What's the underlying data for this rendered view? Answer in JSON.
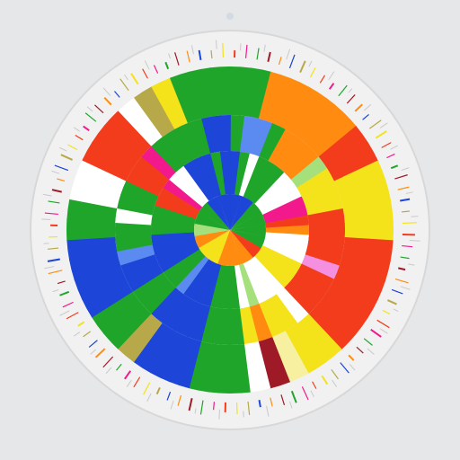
{
  "canvas": {
    "background": "#e6e7e9",
    "disc_fill": "#f1f1f1",
    "disc_stroke": "#d8d8d8",
    "top_dot": "#d4dae2"
  },
  "palette": {
    "red": "#f23c1c",
    "orange": "#ff8c10",
    "yellow": "#f4e21a",
    "lightyellow": "#f7f0a0",
    "green": "#1fa62a",
    "lightgreen": "#a6e07d",
    "blue": "#1d45d8",
    "lightblue": "#5b8af0",
    "magenta": "#f2198c",
    "pink": "#f58fe0",
    "white": "#ffffff",
    "cream": "#f6f4ea",
    "olive": "#b7a84a",
    "darkred": "#9e1a26"
  },
  "wheel": {
    "outer_ring": [
      "green",
      "green",
      "orange",
      "orange",
      "orange",
      "orange",
      "orange",
      "red",
      "red",
      "yellow",
      "yellow",
      "yellow",
      "yellow",
      "red",
      "red",
      "red",
      "red",
      "red",
      "red",
      "yellow",
      "yellow",
      "lightyellow",
      "darkred",
      "white",
      "green",
      "green",
      "green",
      "blue",
      "blue",
      "blue",
      "olive",
      "green",
      "green",
      "blue",
      "blue",
      "blue",
      "blue",
      "green",
      "green",
      "white",
      "white",
      "red",
      "red",
      "red",
      "white",
      "olive",
      "yellow",
      "green",
      "green",
      "green"
    ],
    "middle_ring": [
      "green",
      "lightblue",
      "lightblue",
      "green",
      "orange",
      "orange",
      "orange",
      "lightgreen",
      "yellow",
      "yellow",
      "yellow",
      "red",
      "red",
      "red",
      "red",
      "pink",
      "red",
      "red",
      "red",
      "white",
      "yellow",
      "yellow",
      "orange",
      "yellow",
      "green",
      "green",
      "green",
      "blue",
      "blue",
      "blue",
      "blue",
      "green",
      "green",
      "blue",
      "blue",
      "lightblue",
      "green",
      "green",
      "white",
      "green",
      "green",
      "red",
      "red",
      "magenta",
      "green",
      "green",
      "green",
      "green",
      "blue",
      "blue"
    ],
    "inner_ring": [
      "blue",
      "green",
      "white",
      "green",
      "green",
      "green",
      "white",
      "white",
      "white",
      "magenta",
      "magenta",
      "red",
      "orange",
      "white",
      "white",
      "white",
      "yellow",
      "yellow",
      "yellow",
      "white",
      "white",
      "white",
      "lightgreen",
      "white",
      "green",
      "green",
      "green",
      "blue",
      "blue",
      "blue",
      "lightblue",
      "green",
      "green",
      "blue",
      "blue",
      "blue",
      "blue",
      "green",
      "green",
      "green",
      "red",
      "red",
      "magenta",
      "white",
      "white",
      "blue",
      "blue",
      "blue",
      "green",
      "blue"
    ],
    "hub": [
      "blue",
      "blue",
      "green",
      "green",
      "green",
      "green",
      "red",
      "orange",
      "orange",
      "orange",
      "yellow",
      "yellow",
      "orange",
      "lightgreen",
      "green",
      "green",
      "blue",
      "blue"
    ]
  },
  "tick_colors": [
    "red",
    "blue",
    "green",
    "yellow",
    "orange",
    "magenta",
    "olive",
    "darkred"
  ]
}
